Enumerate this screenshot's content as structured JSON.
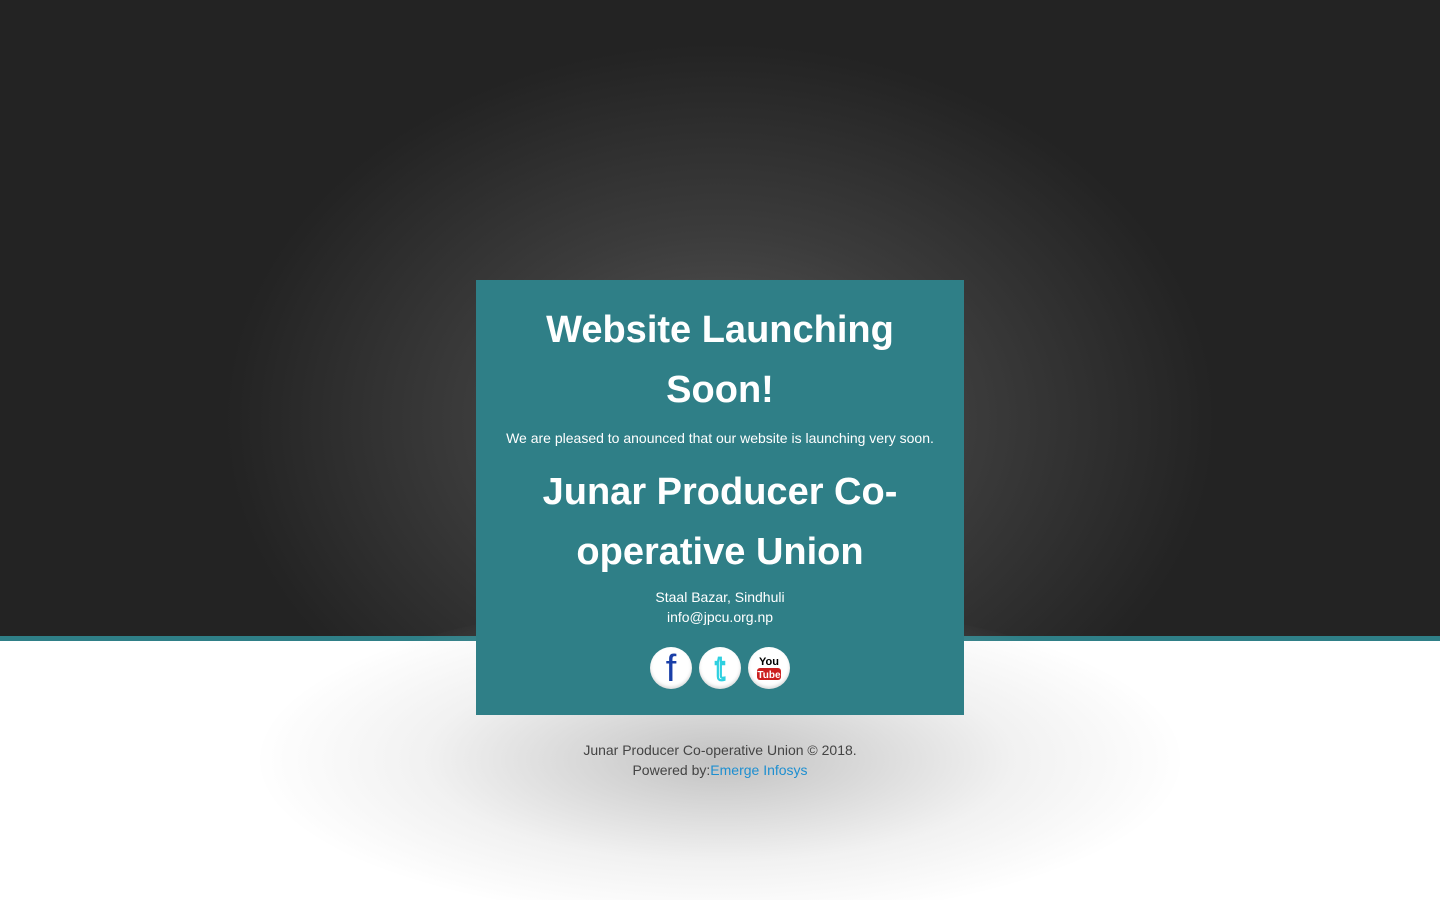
{
  "hero": {
    "headline": "Website Launching Soon!",
    "intro": "We are pleased to anounced that our website is launching very soon.",
    "org_name": "Junar Producer Co-operative Union",
    "address": "Staal Bazar, Sindhuli",
    "email": "info@jpcu.org.np"
  },
  "social": [
    {
      "icon": "facebook-icon",
      "glyph": "f"
    },
    {
      "icon": "twitter-icon",
      "glyph": "t"
    },
    {
      "icon": "youtube-icon",
      "glyph_top": "You",
      "glyph_bottom": "Tube"
    }
  ],
  "footer": {
    "copyright": "Junar Producer Co-operative Union © 2018.",
    "powered_by_label": "Powered by:",
    "powered_by_link": "Emerge Infosys"
  },
  "colors": {
    "top_background": "#232323",
    "accent_teal": "#2f7f87",
    "link_blue": "#1e8fd0",
    "facebook_blue": "#1a3fa8",
    "twitter_cyan": "#2fd0e0",
    "youtube_red": "#cc1f1f"
  }
}
